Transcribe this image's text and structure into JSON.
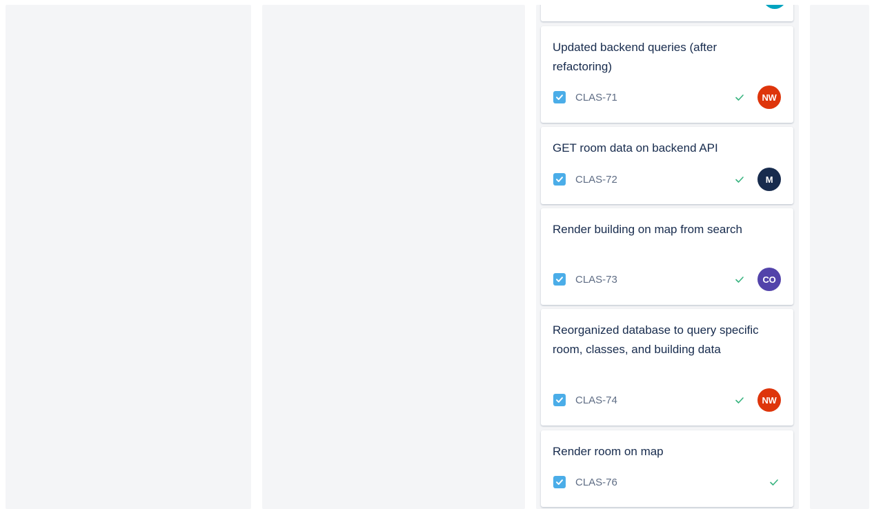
{
  "board": {
    "cards": [
      {
        "title": "Updated backend queries (after refactoring)",
        "key": "CLAS-71",
        "avatar": {
          "initials": "NW",
          "color": "#de350b"
        }
      },
      {
        "title": "GET room data on backend API",
        "key": "CLAS-72",
        "avatar": {
          "initials": "M",
          "color": "#172b4d"
        }
      },
      {
        "title": "Render building on map from search",
        "key": "CLAS-73",
        "avatar": {
          "initials": "CO",
          "color": "#5243aa"
        }
      },
      {
        "title": "Reorganized database to query specific room, classes, and building data",
        "key": "CLAS-74",
        "avatar": {
          "initials": "NW",
          "color": "#de350b"
        }
      },
      {
        "title": "Render room on map",
        "key": "CLAS-76",
        "avatar": null
      }
    ],
    "partial_avatar_color": "#00a3bf",
    "colors": {
      "story_icon": "#4bade8",
      "done_check": "#36b37e",
      "column_bg": "#f4f5f7"
    },
    "icons": {
      "type": "checkbox-task-icon",
      "done": "checkmark-icon"
    }
  }
}
